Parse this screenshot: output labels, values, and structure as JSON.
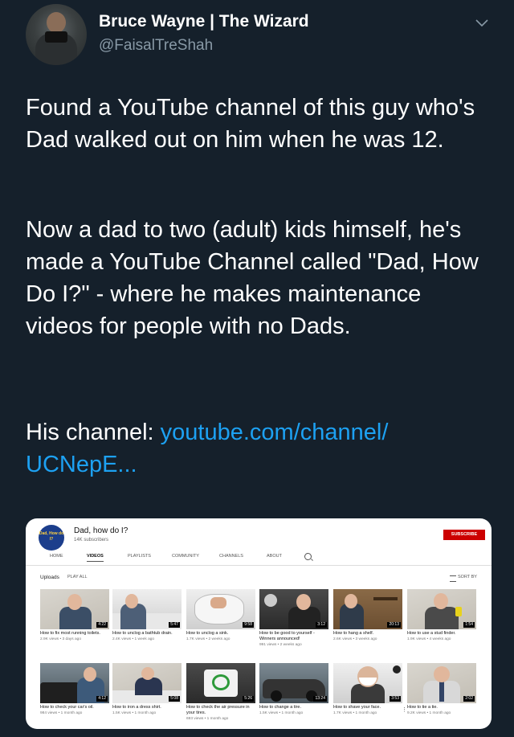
{
  "tweet": {
    "display_name": "Bruce Wayne | The Wizard",
    "handle": "@FaisalTreShah",
    "paragraph1": "Found a YouTube channel of this guy who's Dad walked out on him when he was 12.",
    "paragraph2": "Now a dad to two (adult) kids himself, he's made a YouTube Channel called \"Dad, How Do I?\" - where he makes maintenance videos for people with no Dads.",
    "paragraph3_prefix": "His channel: ",
    "paragraph3_link": "youtube.com/channel/ UCNepE..."
  },
  "channel": {
    "logo_text": "Dad, How do I?",
    "name": "Dad, how do I?",
    "subscribers": "14K subscribers",
    "subscribe_label": "SUBSCRIBE",
    "tabs": [
      "HOME",
      "VIDEOS",
      "PLAYLISTS",
      "COMMUNITY",
      "CHANNELS",
      "ABOUT"
    ],
    "active_tab": "VIDEOS",
    "section_title": "Uploads",
    "play_all": "PLAY ALL",
    "sort_by": "SORT BY",
    "videos": [
      {
        "title": "How to fix most running toilets.",
        "meta": "2.9K views • 3 days ago",
        "duration": "4:22"
      },
      {
        "title": "How to unclog a bathtub drain.",
        "meta": "2.4K views • 1 week ago",
        "duration": "5:47"
      },
      {
        "title": "How to unclog a sink.",
        "meta": "1.7K views • 2 weeks ago",
        "duration": "9:58"
      },
      {
        "title": "How to be good to yourself - Winners announced!",
        "meta": "991 views • 2 weeks ago",
        "duration": "3:12"
      },
      {
        "title": "How to hang a shelf.",
        "meta": "2.6K views • 3 weeks ago",
        "duration": "20:13"
      },
      {
        "title": "How to use a stud finder.",
        "meta": "1.9K views • 4 weeks ago",
        "duration": "1:54"
      },
      {
        "title": "How to check your car's oil.",
        "meta": "984 views • 1 month ago",
        "duration": "4:12"
      },
      {
        "title": "How to iron a dress shirt.",
        "meta": "1.5K views • 1 month ago",
        "duration": "5:08"
      },
      {
        "title": "How to check the air pressure in your tires.",
        "meta": "693 views • 1 month ago",
        "duration": "5:26"
      },
      {
        "title": "How to change a tire.",
        "meta": "1.5K views • 1 month ago",
        "duration": "13:24"
      },
      {
        "title": "How to shave your face.",
        "meta": "1.7K views • 1 month ago",
        "duration": "3:53"
      },
      {
        "title": "How to tie a tie.",
        "meta": "9.2K views • 1 month ago",
        "duration": "2:02"
      }
    ]
  }
}
